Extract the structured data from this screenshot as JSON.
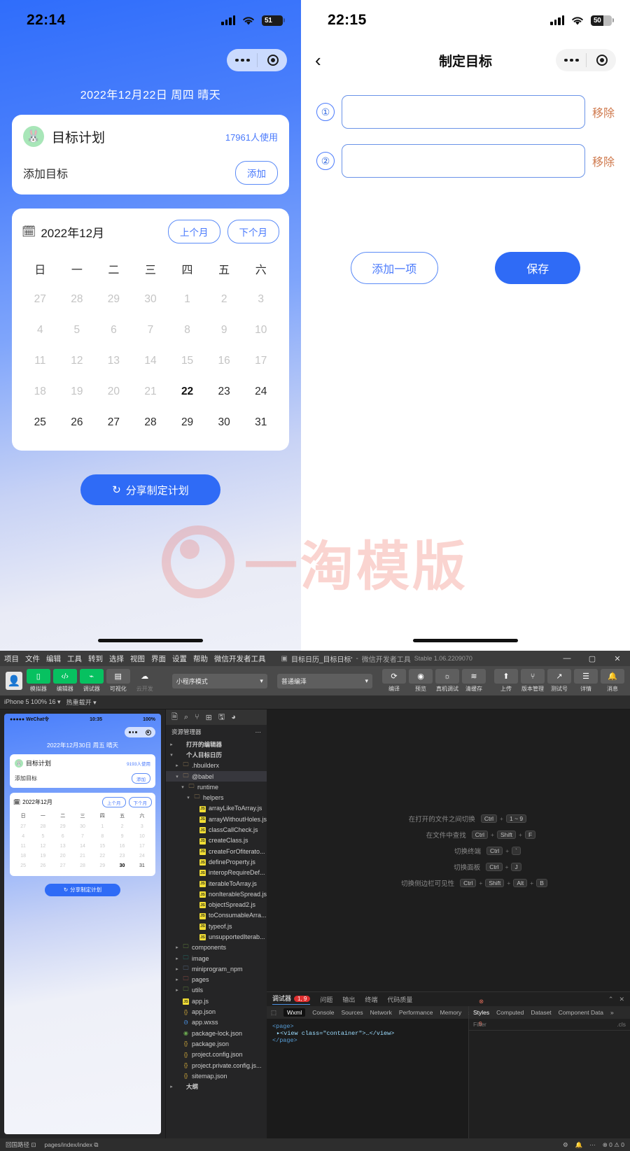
{
  "left_phone": {
    "status": {
      "time": "22:14",
      "battery": "51",
      "signal_icon": "cellular-bars-icon",
      "wifi_icon": "wifi-icon"
    },
    "capsule": {
      "more_icon": "more-dots-icon",
      "target_icon": "target-circle-icon"
    },
    "date_line": "2022年12月22日 周四 晴天",
    "plan_card": {
      "avatar_icon": "rabbit-avatar-icon",
      "title": "目标计划",
      "users": "17961人使用",
      "add_label": "添加目标",
      "add_button": "添加"
    },
    "calendar": {
      "icon": "calendar-icon",
      "title": "2022年12月",
      "prev_button": "上个月",
      "next_button": "下个月",
      "weekdays": [
        "日",
        "一",
        "二",
        "三",
        "四",
        "五",
        "六"
      ],
      "days": [
        {
          "d": "27",
          "state": "dim"
        },
        {
          "d": "28",
          "state": "dim"
        },
        {
          "d": "29",
          "state": "dim"
        },
        {
          "d": "30",
          "state": "dim"
        },
        {
          "d": "1",
          "state": "dim"
        },
        {
          "d": "2",
          "state": "dim"
        },
        {
          "d": "3",
          "state": "dim"
        },
        {
          "d": "4",
          "state": "dim"
        },
        {
          "d": "5",
          "state": "dim"
        },
        {
          "d": "6",
          "state": "dim"
        },
        {
          "d": "7",
          "state": "dim"
        },
        {
          "d": "8",
          "state": "dim"
        },
        {
          "d": "9",
          "state": "dim"
        },
        {
          "d": "10",
          "state": "dim"
        },
        {
          "d": "11",
          "state": "dim"
        },
        {
          "d": "12",
          "state": "dim"
        },
        {
          "d": "13",
          "state": "dim"
        },
        {
          "d": "14",
          "state": "dim"
        },
        {
          "d": "15",
          "state": "dim"
        },
        {
          "d": "16",
          "state": "dim"
        },
        {
          "d": "17",
          "state": "dim"
        },
        {
          "d": "18",
          "state": "dim"
        },
        {
          "d": "19",
          "state": "dim"
        },
        {
          "d": "20",
          "state": "dim"
        },
        {
          "d": "21",
          "state": "dim"
        },
        {
          "d": "22",
          "state": "today"
        },
        {
          "d": "23",
          "state": "normal"
        },
        {
          "d": "24",
          "state": "normal"
        },
        {
          "d": "25",
          "state": "normal"
        },
        {
          "d": "26",
          "state": "normal"
        },
        {
          "d": "27",
          "state": "normal"
        },
        {
          "d": "28",
          "state": "normal"
        },
        {
          "d": "29",
          "state": "normal"
        },
        {
          "d": "30",
          "state": "normal"
        },
        {
          "d": "31",
          "state": "normal"
        }
      ]
    },
    "share_button": {
      "label": "分享制定计划",
      "icon": "refresh-share-icon"
    }
  },
  "watermark": {
    "text": "一淘模版",
    "logo_icon": "taobao-logo-icon"
  },
  "right_phone": {
    "status": {
      "time": "22:15",
      "battery": "50",
      "signal_icon": "cellular-bars-icon",
      "wifi_icon": "wifi-icon"
    },
    "back_icon": "chevron-left-icon",
    "title": "制定目标",
    "capsule": {
      "more_icon": "more-dots-icon",
      "target_icon": "target-circle-icon"
    },
    "goals": [
      {
        "num": "①",
        "value": "",
        "placeholder": "",
        "remove": "移除"
      },
      {
        "num": "②",
        "value": "",
        "placeholder": "",
        "remove": "移除"
      }
    ],
    "add_item_button": "添加一项",
    "save_button": "保存"
  },
  "ide": {
    "menus": [
      "项目",
      "文件",
      "编辑",
      "工具",
      "转到",
      "选择",
      "视图",
      "界面",
      "设置",
      "帮助",
      "微信开发者工具"
    ],
    "doc_title": "目标日历_目标日标'",
    "app_name": "微信开发者工具",
    "version": "Stable 1.06.2209070",
    "window_controls": [
      "—",
      "▢",
      "✕"
    ],
    "toolbar": {
      "buttons": [
        {
          "label": "模拟器",
          "icon": "simulator-icon",
          "style": "green",
          "glyph": "▯"
        },
        {
          "label": "编辑器",
          "icon": "editor-icon",
          "style": "green",
          "glyph": "‹/›"
        },
        {
          "label": "调试器",
          "icon": "debugger-icon",
          "style": "green",
          "glyph": "⌁"
        },
        {
          "label": "可视化",
          "icon": "visual-icon",
          "style": "grey",
          "glyph": "▤"
        },
        {
          "label": "云开发",
          "icon": "cloud-icon",
          "style": "flat",
          "glyph": "☁"
        }
      ],
      "mode_select": "小程序模式",
      "editor_select": "普通编泽",
      "actions": [
        {
          "label": "编译",
          "icon": "compile-icon",
          "glyph": "⟳"
        },
        {
          "label": "预览",
          "icon": "preview-icon",
          "glyph": "◉"
        },
        {
          "label": "真机调试",
          "icon": "realdevice-icon",
          "glyph": "☼"
        },
        {
          "label": "清缓存",
          "icon": "clearcache-icon",
          "glyph": "≋"
        }
      ],
      "right_actions": [
        {
          "label": "上传",
          "icon": "upload-icon",
          "glyph": "⬆"
        },
        {
          "label": "版本管理",
          "icon": "version-icon",
          "glyph": "⑂"
        },
        {
          "label": "测试号",
          "icon": "testid-icon",
          "glyph": "↗"
        },
        {
          "label": "详情",
          "icon": "details-icon",
          "glyph": "☰"
        },
        {
          "label": "消息",
          "icon": "message-icon",
          "glyph": "🔔"
        }
      ]
    },
    "simulator": {
      "device_label": "iPhone 5 100% 16 ▾",
      "scale_label": "热重载开 ▾",
      "screen": {
        "carrier": "●●●●● WeChat令",
        "time": "10:35",
        "battery": "100%",
        "date_line": "2022年12月30日 周五 晴天",
        "plan_title": "目标计划",
        "plan_users": "9193人使用",
        "add_label": "添加目标",
        "add_button": "添加",
        "cal_title": "2022年12月",
        "prev_button": "上个月",
        "next_button": "下个月",
        "weekdays": [
          "日",
          "一",
          "二",
          "三",
          "四",
          "五",
          "六"
        ],
        "days": [
          {
            "d": "27",
            "state": "dim"
          },
          {
            "d": "28",
            "state": "dim"
          },
          {
            "d": "29",
            "state": "dim"
          },
          {
            "d": "30",
            "state": "dim"
          },
          {
            "d": "1",
            "state": "dim"
          },
          {
            "d": "2",
            "state": "dim"
          },
          {
            "d": "3",
            "state": "dim"
          },
          {
            "d": "4",
            "state": "dim"
          },
          {
            "d": "5",
            "state": "dim"
          },
          {
            "d": "6",
            "state": "dim"
          },
          {
            "d": "7",
            "state": "dim"
          },
          {
            "d": "8",
            "state": "dim"
          },
          {
            "d": "9",
            "state": "dim"
          },
          {
            "d": "10",
            "state": "dim"
          },
          {
            "d": "11",
            "state": "dim"
          },
          {
            "d": "12",
            "state": "dim"
          },
          {
            "d": "13",
            "state": "dim"
          },
          {
            "d": "14",
            "state": "dim"
          },
          {
            "d": "15",
            "state": "dim"
          },
          {
            "d": "16",
            "state": "dim"
          },
          {
            "d": "17",
            "state": "dim"
          },
          {
            "d": "18",
            "state": "dim"
          },
          {
            "d": "19",
            "state": "dim"
          },
          {
            "d": "20",
            "state": "dim"
          },
          {
            "d": "21",
            "state": "dim"
          },
          {
            "d": "22",
            "state": "dim"
          },
          {
            "d": "23",
            "state": "dim"
          },
          {
            "d": "24",
            "state": "dim"
          },
          {
            "d": "25",
            "state": "dim"
          },
          {
            "d": "26",
            "state": "dim"
          },
          {
            "d": "27",
            "state": "dim"
          },
          {
            "d": "28",
            "state": "dim"
          },
          {
            "d": "29",
            "state": "dim"
          },
          {
            "d": "30",
            "state": "today"
          },
          {
            "d": "31",
            "state": "normal"
          }
        ],
        "share_button": "分享制定计划"
      }
    },
    "explorer": {
      "panel_title": "资源管理器",
      "icons": [
        "files-icon",
        "search-icon",
        "source-control-icon",
        "extensions-icon",
        "save-icon",
        "debug-icon"
      ],
      "tree": [
        {
          "indent": 0,
          "tw": "▸",
          "icon": "",
          "label": "打开的编辑器",
          "type": "section"
        },
        {
          "indent": 0,
          "tw": "▾",
          "icon": "",
          "label": "个人目标日历",
          "type": "root"
        },
        {
          "indent": 1,
          "tw": "▸",
          "icon": "folder",
          "label": ".hbuilderx",
          "type": "folder"
        },
        {
          "indent": 1,
          "tw": "▾",
          "icon": "folder",
          "label": "@babel",
          "type": "folder",
          "selected": true
        },
        {
          "indent": 2,
          "tw": "▾",
          "icon": "folder",
          "label": "runtime",
          "type": "folder"
        },
        {
          "indent": 3,
          "tw": "▾",
          "icon": "folder",
          "label": "helpers",
          "type": "folder"
        },
        {
          "indent": 4,
          "tw": "",
          "icon": "js",
          "label": "arrayLikeToArray.js",
          "type": "file"
        },
        {
          "indent": 4,
          "tw": "",
          "icon": "js",
          "label": "arrayWithoutHoles.js",
          "type": "file"
        },
        {
          "indent": 4,
          "tw": "",
          "icon": "js",
          "label": "classCallCheck.js",
          "type": "file"
        },
        {
          "indent": 4,
          "tw": "",
          "icon": "js",
          "label": "createClass.js",
          "type": "file"
        },
        {
          "indent": 4,
          "tw": "",
          "icon": "js",
          "label": "createForOfiterato...",
          "type": "file"
        },
        {
          "indent": 4,
          "tw": "",
          "icon": "js",
          "label": "defineProperty.js",
          "type": "file"
        },
        {
          "indent": 4,
          "tw": "",
          "icon": "js",
          "label": "interopRequireDef...",
          "type": "file"
        },
        {
          "indent": 4,
          "tw": "",
          "icon": "js",
          "label": "iterableToArray.js",
          "type": "file"
        },
        {
          "indent": 4,
          "tw": "",
          "icon": "js",
          "label": "nonIterableSpread.js",
          "type": "file"
        },
        {
          "indent": 4,
          "tw": "",
          "icon": "js",
          "label": "objectSpread2.js",
          "type": "file"
        },
        {
          "indent": 4,
          "tw": "",
          "icon": "js",
          "label": "toConsumableArra...",
          "type": "file"
        },
        {
          "indent": 4,
          "tw": "",
          "icon": "js",
          "label": "typeof.js",
          "type": "file"
        },
        {
          "indent": 4,
          "tw": "",
          "icon": "js",
          "label": "unsupportedIterab...",
          "type": "file"
        },
        {
          "indent": 1,
          "tw": "▸",
          "icon": "folder-green",
          "label": "components",
          "type": "folder"
        },
        {
          "indent": 1,
          "tw": "▸",
          "icon": "folder-teal",
          "label": "image",
          "type": "folder"
        },
        {
          "indent": 1,
          "tw": "▸",
          "icon": "folder-blue",
          "label": "miniprogram_npm",
          "type": "folder"
        },
        {
          "indent": 1,
          "tw": "▸",
          "icon": "folder-red",
          "label": "pages",
          "type": "folder"
        },
        {
          "indent": 1,
          "tw": "▸",
          "icon": "folder-green",
          "label": "utils",
          "type": "folder"
        },
        {
          "indent": 1,
          "tw": "",
          "icon": "js",
          "label": "app.js",
          "type": "file"
        },
        {
          "indent": 1,
          "tw": "",
          "icon": "json",
          "label": "app.json",
          "type": "file"
        },
        {
          "indent": 1,
          "tw": "",
          "icon": "wxss",
          "label": "app.wxss",
          "type": "file"
        },
        {
          "indent": 1,
          "tw": "",
          "icon": "lock",
          "label": "package-lock.json",
          "type": "file"
        },
        {
          "indent": 1,
          "tw": "",
          "icon": "json",
          "label": "package.json",
          "type": "file"
        },
        {
          "indent": 1,
          "tw": "",
          "icon": "json",
          "label": "project.config.json",
          "type": "file"
        },
        {
          "indent": 1,
          "tw": "",
          "icon": "json",
          "label": "project.private.config.js...",
          "type": "file"
        },
        {
          "indent": 1,
          "tw": "",
          "icon": "json",
          "label": "sitemap.json",
          "type": "file"
        },
        {
          "indent": 0,
          "tw": "▸",
          "icon": "",
          "label": "大纲",
          "type": "section"
        }
      ]
    },
    "editor": {
      "shortcuts": [
        {
          "label": "在打开的文件之间切换",
          "keys": [
            "Ctrl",
            "1 ~ 9"
          ]
        },
        {
          "label": "在文件中查找",
          "keys": [
            "Ctrl",
            "Shift",
            "F"
          ]
        },
        {
          "label": "切换终端",
          "keys": [
            "Ctrl",
            "`"
          ]
        },
        {
          "label": "切换面板",
          "keys": [
            "Ctrl",
            "J"
          ]
        },
        {
          "label": "切换侧边栏可见性",
          "keys": [
            "Ctrl",
            "Shift",
            "Alt",
            "B"
          ]
        }
      ]
    },
    "devtools": {
      "tabs": [
        {
          "label": "调试器",
          "badge": "1, 9",
          "active": true
        },
        {
          "label": "问题",
          "badge": "",
          "active": false
        },
        {
          "label": "输出",
          "badge": "",
          "active": false
        },
        {
          "label": "终端",
          "badge": "",
          "active": false
        },
        {
          "label": "代码质量",
          "badge": "",
          "active": false
        }
      ],
      "inner_tabs": [
        "Wxml",
        "Console",
        "Sources",
        "Network",
        "Performance",
        "Memory",
        "»"
      ],
      "active_inner_tab": "Wxml",
      "errors": "1",
      "warnings": "9",
      "wxml_lines": [
        "▸<view class=\"container\">…</view>",
        "</page>"
      ],
      "wxml_root": "<page>",
      "style_tabs": [
        "Styles",
        "Computed",
        "Dataset",
        "Component Data",
        "»"
      ],
      "active_style_tab": "Styles",
      "filter_placeholder": "Filter",
      "cls_label": ".cls"
    },
    "statusline": {
      "left": "回国路径 ⊡",
      "path": "pages/index/index ⧉",
      "right_icons": [
        "settings-icon",
        "bell-icon",
        "more-icon"
      ],
      "counts": "⊗ 0  ⚠ 0"
    }
  }
}
